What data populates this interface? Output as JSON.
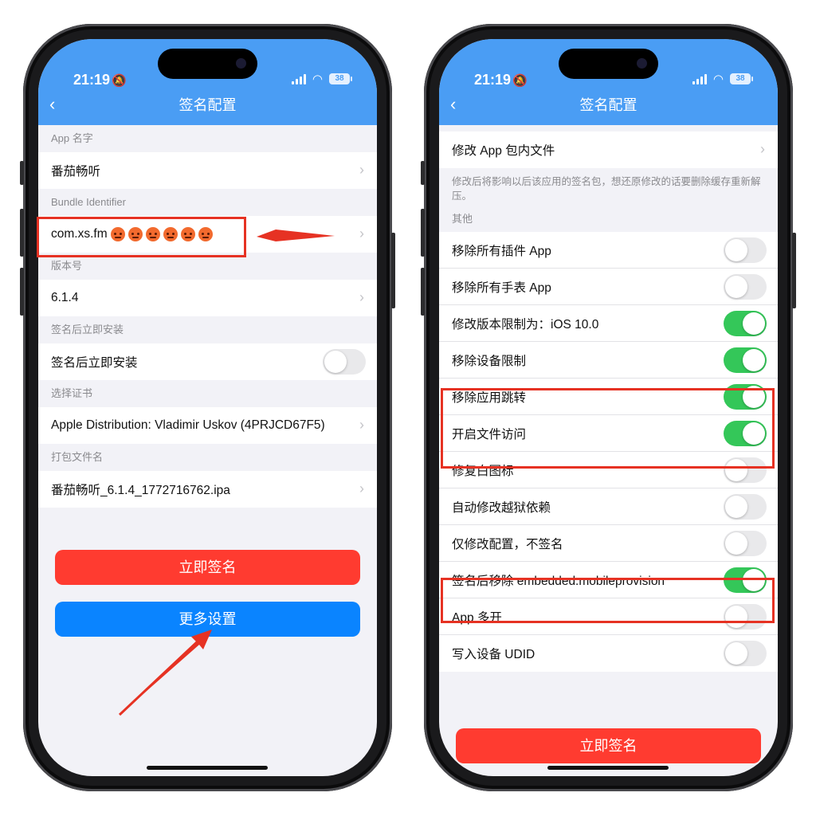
{
  "colors": {
    "accent_red": "#ff3b30",
    "accent_blue": "#0a84ff",
    "toggle_on": "#34c759",
    "annotation_red": "#e63223",
    "navbar": "#4a9df4"
  },
  "left_phone": {
    "status": {
      "time": "21:19",
      "battery": "38"
    },
    "nav": {
      "title": "签名配置"
    },
    "sections": [
      {
        "header": "App 名字",
        "value": "番茄畅听"
      },
      {
        "header": "Bundle Identifier",
        "value": "com.xs.fm"
      },
      {
        "header": "版本号",
        "value": "6.1.4"
      },
      {
        "header": "签名后立即安装",
        "value": "签名后立即安装"
      },
      {
        "header": "选择证书",
        "value": "Apple Distribution: Vladimir Uskov (4PRJCD67F5)"
      },
      {
        "header": "打包文件名",
        "value": "番茄畅听_6.1.4_1772716762.ipa"
      }
    ],
    "sign_button": "立即签名",
    "more_settings_button": "更多设置"
  },
  "right_phone": {
    "status": {
      "time": "21:19",
      "battery": "38"
    },
    "nav": {
      "title": "签名配置"
    },
    "modify_files": "修改 App 包内文件",
    "note": "修改后将影响以后该应用的签名包，想还原修改的话要删除缓存重新解压。",
    "other_header": "其他",
    "options": [
      {
        "label": "移除所有插件 App",
        "on": false
      },
      {
        "label": "移除所有手表 App",
        "on": false
      },
      {
        "label": "修改版本限制为：iOS 10.0",
        "on": true
      },
      {
        "label": "移除设备限制",
        "on": true
      },
      {
        "label": "移除应用跳转",
        "on": true
      },
      {
        "label": "开启文件访问",
        "on": true
      },
      {
        "label": "修复白图标",
        "on": false
      },
      {
        "label": "自动修改越狱依赖",
        "on": false
      },
      {
        "label": "仅修改配置，不签名",
        "on": false
      },
      {
        "label": "签名后移除 embedded.mobileprovision",
        "on": true
      },
      {
        "label": "App 多开",
        "on": false
      },
      {
        "label": "写入设备 UDID",
        "on": false
      }
    ],
    "sign_button": "立即签名"
  }
}
